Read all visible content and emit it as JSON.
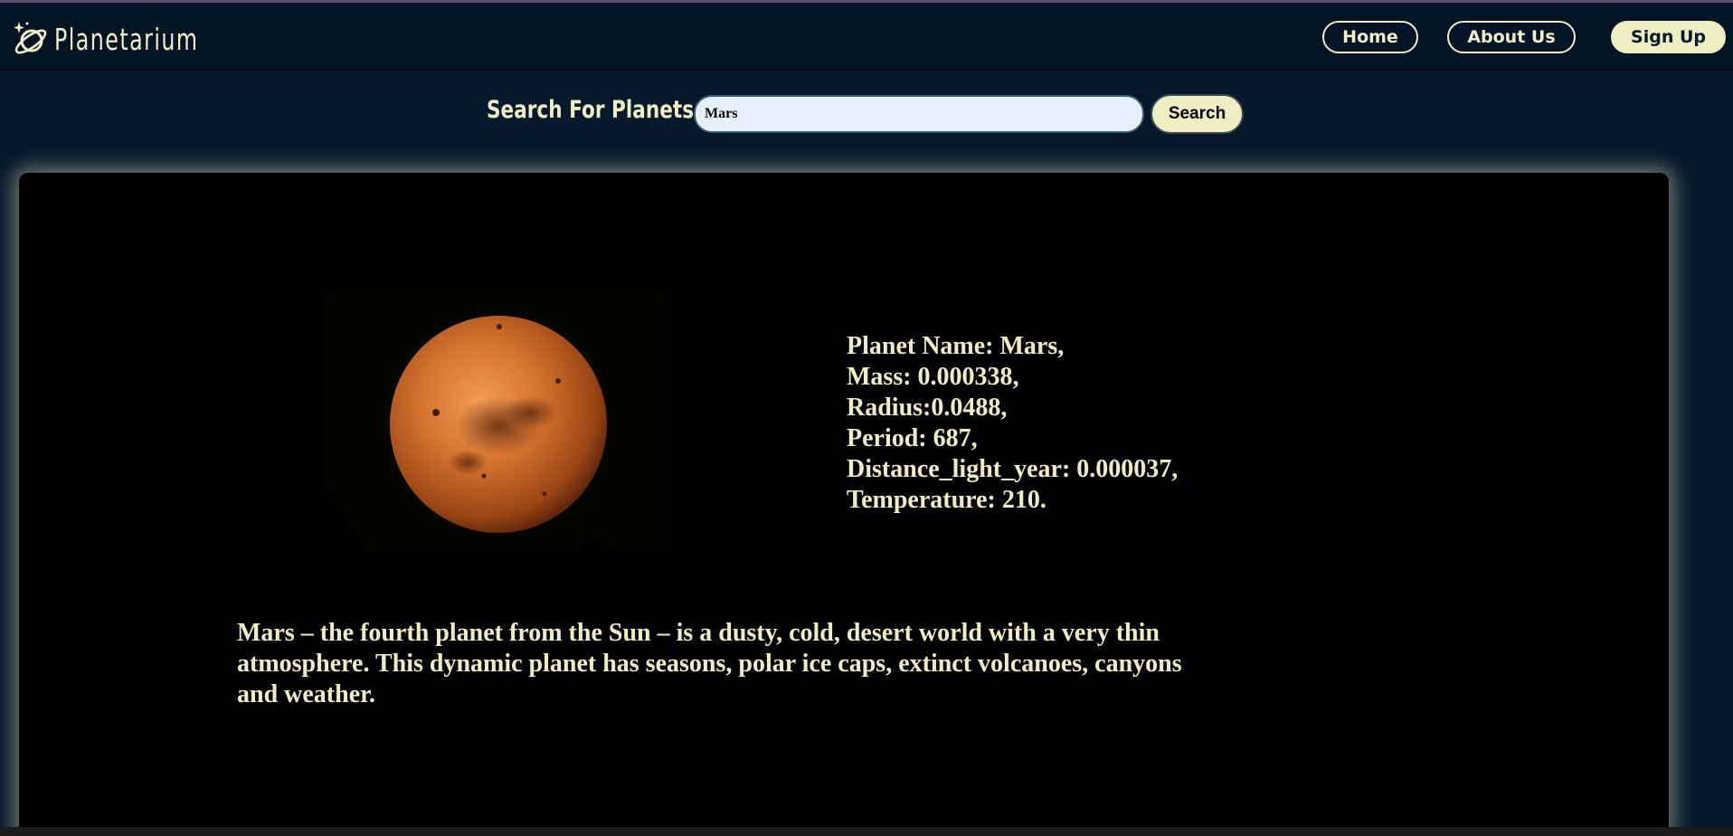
{
  "app": {
    "name": "Planetarium"
  },
  "nav": {
    "home": "Home",
    "about": "About Us",
    "signup": "Sign Up"
  },
  "search": {
    "label": "Search For Planets",
    "value": "Mars",
    "button": "Search"
  },
  "planet": {
    "name_line": "Planet Name: Mars,",
    "mass_line": "Mass: 0.000338,",
    "radius_line": "Radius:0.0488,",
    "period_line": "Period: 687,",
    "distance_line": "Distance_light_year: 0.000037,",
    "temperature_line": "Temperature: 210.",
    "description": "Mars – the fourth planet from the Sun – is a dusty, cold, desert world with a very thin atmosphere. This dynamic planet has seasons, polar ice caps, extinct volcanoes, canyons and weather."
  },
  "colors": {
    "accent": "#efedc2",
    "navbar": "#031424",
    "page_bg": "#06192b",
    "card_bg": "#000000",
    "planet": "#c8642a"
  },
  "icons": {
    "logo": "ringed-planet-icon"
  }
}
